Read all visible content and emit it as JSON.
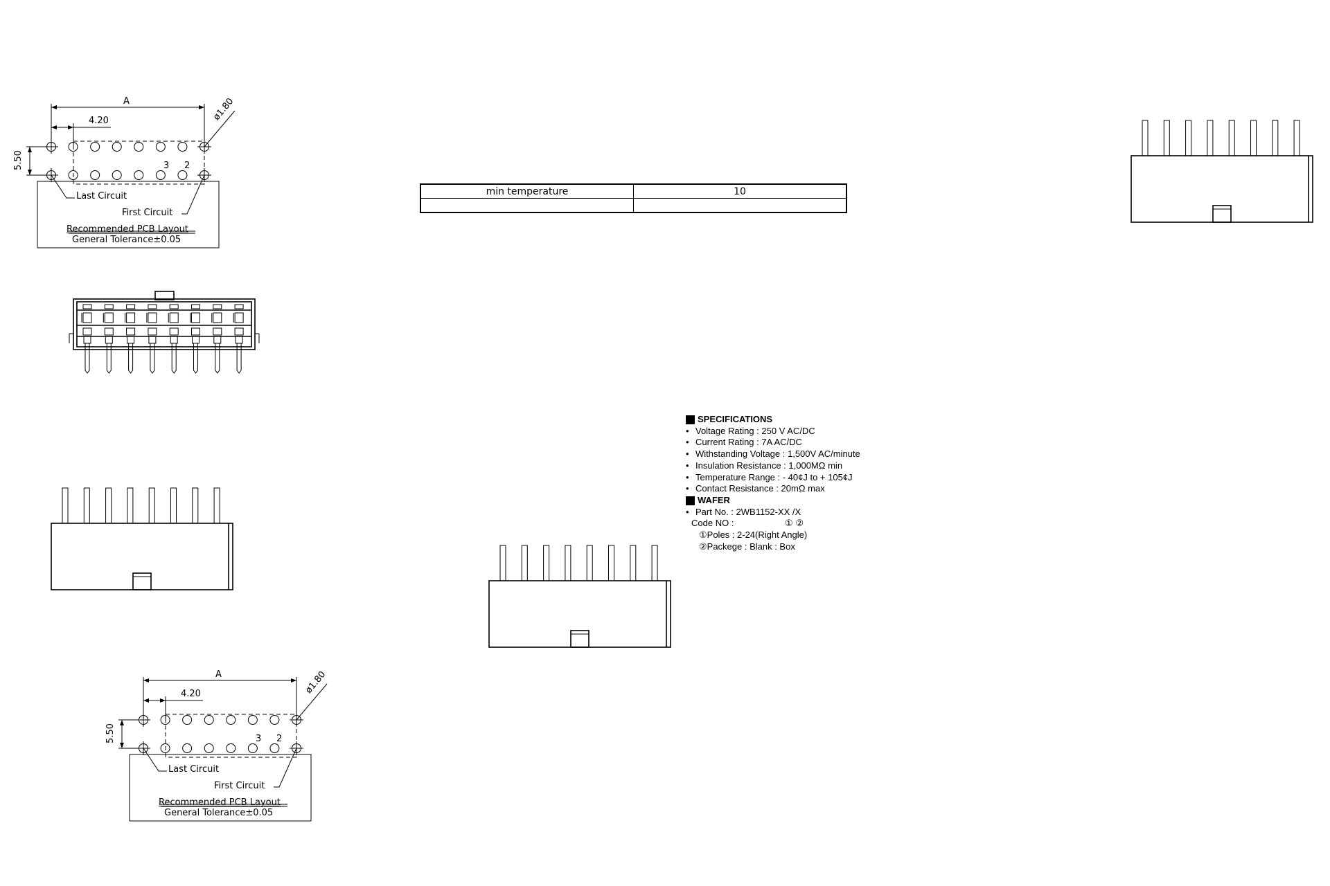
{
  "pcb_layout": {
    "dim_a": "A",
    "dim_pitch": "4.20",
    "dim_row": "5.50",
    "dim_hole": "ø1.80",
    "pin_3": "3",
    "pin_2": "2",
    "last_circuit": "Last Circuit",
    "first_circuit": "First Circuit",
    "title": "Recommended PCB Layout",
    "tolerance": "General Tolerance±0.05"
  },
  "table": {
    "rows": [
      [
        "min temperature",
        "10"
      ],
      [
        "",
        ""
      ]
    ]
  },
  "specs": {
    "heading": "SPECIFICATIONS",
    "items": [
      "Voltage Rating : 250 V AC/DC",
      "Current Rating : 7A AC/DC",
      "Withstanding Voltage : 1,500V AC/minute",
      "Insulation Resistance : 1,000MΩ  min",
      "Temperature Range : - 40¢J to + 105¢J",
      "Contact Resistance : 20mΩ  max"
    ],
    "wafer_heading": "WAFER",
    "part_no": "Part No. :  2WB1152-XX /X",
    "code_no_label": "Code NO :",
    "code_no_marks": "① ②",
    "poles": "①Poles : 2-24(Right Angle)",
    "package": "②Packege : Blank : Box"
  }
}
